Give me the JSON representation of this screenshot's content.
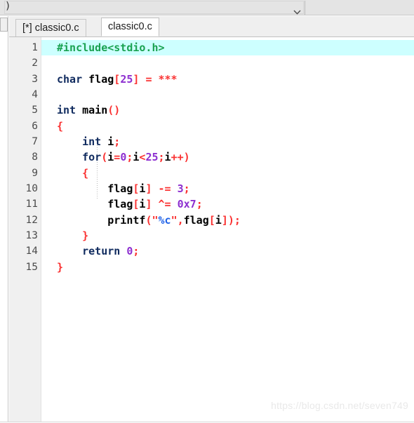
{
  "toolbar": {
    "leading_glyph": ")",
    "dropdown_icon": "chevron-down-icon",
    "combo_value": ""
  },
  "tabs": [
    {
      "label": "[*] classic0.c",
      "active": false
    },
    {
      "label": "classic0.c",
      "active": true
    }
  ],
  "editor": {
    "current_line": 1,
    "highlight_color": "#cdffff",
    "gutter_numbers": [
      "1",
      "2",
      "3",
      "4",
      "5",
      "6",
      "7",
      "8",
      "9",
      "10",
      "11",
      "12",
      "13",
      "14",
      "15"
    ],
    "lines": [
      {
        "n": "1",
        "text": "#include<stdio.h>"
      },
      {
        "n": "2",
        "text": ""
      },
      {
        "n": "3",
        "text": "char flag[25] = ***"
      },
      {
        "n": "4",
        "text": ""
      },
      {
        "n": "5",
        "text": "int main()"
      },
      {
        "n": "6",
        "text": "{"
      },
      {
        "n": "7",
        "text": "    int i;"
      },
      {
        "n": "8",
        "text": "    for(i=0;i<25;i++)"
      },
      {
        "n": "9",
        "text": "    {"
      },
      {
        "n": "10",
        "text": "        flag[i] -= 3;"
      },
      {
        "n": "11",
        "text": "        flag[i] ^= 0x7;"
      },
      {
        "n": "12",
        "text": "        printf(\"%c\",flag[i]);"
      },
      {
        "n": "13",
        "text": "    }"
      },
      {
        "n": "14",
        "text": "    return 0;"
      },
      {
        "n": "15",
        "text": "}"
      }
    ],
    "fold_markers": [
      {
        "line": 6,
        "type": "collapse-box"
      },
      {
        "line": 9,
        "type": "collapse-box"
      },
      {
        "line": 13,
        "type": "branch-tick"
      },
      {
        "line": 15,
        "type": "fold-end"
      }
    ],
    "colors": {
      "preprocessor": "#1aa251",
      "keyword": "#0f2a5e",
      "identifier": "#000000",
      "operator": "#fa3232",
      "number": "#8d2fd0",
      "string": "#fa3232",
      "format_spec": "#1f62e8",
      "gutter_text": "#4c4c4c",
      "gutter_bg": "#f0f0f0",
      "editor_bg": "#ffffff"
    }
  },
  "watermark": {
    "text": "https://blog.csdn.net/seven749"
  }
}
